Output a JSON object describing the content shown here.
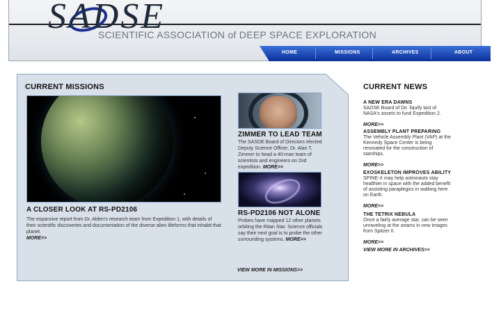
{
  "header": {
    "logo_text": "SADSE",
    "subtitle": "SCIENTIFIC ASSOCIATION of DEEP SPACE EXPLORATION",
    "nav": [
      "HOME",
      "MISSIONS",
      "ARCHIVES",
      "ABOUT"
    ]
  },
  "missions": {
    "heading": "CURRENT MISSIONS",
    "feature": {
      "title": "A CLOSER LOOK AT RS-PD2106",
      "body": "The expansive report from Dr. Alden's research team from Expedition 1, with details of their scientific discoveries and documentation of the diverse alien lifeforms that inhabit that planet.",
      "more": "MORE>>"
    },
    "side1": {
      "title": "ZIMMER TO LEAD TEAM",
      "body": "The SASDE Board of Directors elected Deputy Science Officer, Dr. Alan T. Zimmer to head a 40-man team of scientists and engineers on 2nd expedition.",
      "more": "MORE>>"
    },
    "side2": {
      "title": "RS-PD2106 NOT ALONE",
      "body": "Probes have mapped 12 other planets orbiting the Ritan Star. Science officials say their next goal is to probe the other surrounding systems.",
      "more": "MORE>>"
    },
    "view_more": "VIEW MORE IN MISSIONS>>"
  },
  "news": {
    "heading": "CURRENT NEWS",
    "items": [
      {
        "title": "A NEW ERA DAWNS",
        "body": "SADSE Board of Dir. liquify last of NASA's assets to fund Expedition 2.",
        "more": "MORE>>"
      },
      {
        "title": "ASSEMBLY PLANT PREPARING",
        "body": "The Vehicle Assembly Plant (VAP) at the Kennedy Space Center is being renovated for the construction of starships.",
        "more": "MORE>>"
      },
      {
        "title": "EXOSKELETON IMPROVES ABILITY",
        "body": "SPINE-X may help astronauts stay healthier in space with the added benefit of assisting paraplegics in walking here on Earth.",
        "more": "MORE>>"
      },
      {
        "title": "THE TETRIX NEBULA",
        "body": "Once a fairly average star, can be seen unraveling at the seams in new images from Spitzer II.",
        "more": "MORE>>"
      }
    ],
    "archive_link": "VIEW MORE IN ARCHIVES>>"
  },
  "colors": {
    "nav_blue": "#0b2f9a",
    "panel_bg": "#d8e0e9",
    "panel_border": "#8fa5c2"
  }
}
